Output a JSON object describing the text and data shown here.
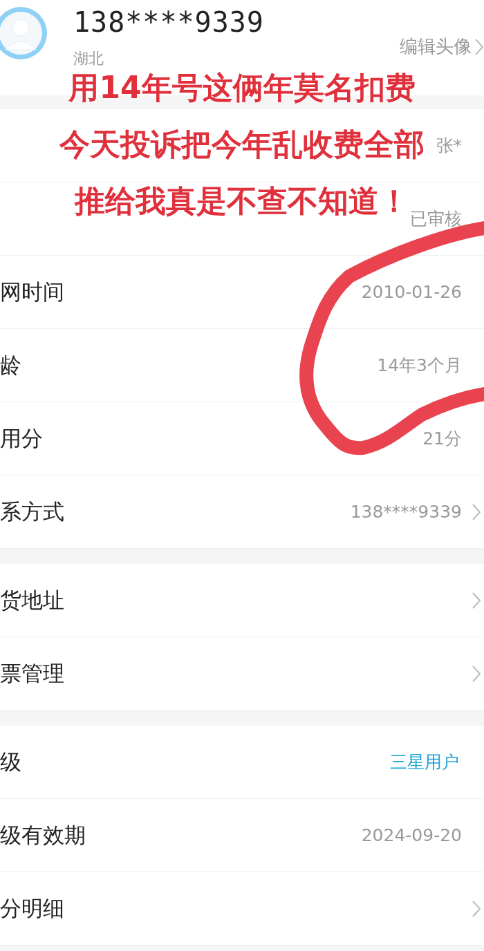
{
  "profile": {
    "phone": "138****9339",
    "region": "湖北",
    "edit_avatar": "编辑头像",
    "chevron": true
  },
  "annotation": {
    "lines": [
      "用14年号这俩年莫名扣费",
      "今天投诉把今年乱收费全部",
      "推给我真是不查不知道！"
    ]
  },
  "sections": [
    [
      {
        "kind": "info",
        "value": "张*",
        "chevron": false
      },
      {
        "kind": "info",
        "value": "已审核",
        "chevron": false
      },
      {
        "kind": "info",
        "label": "网时间",
        "value": "2010-01-26",
        "chevron": false
      },
      {
        "kind": "info",
        "label": "龄",
        "value": "14年3个月",
        "chevron": false
      },
      {
        "kind": "info",
        "label": "用分",
        "value": "21分",
        "chevron": false
      },
      {
        "kind": "info",
        "label": "系方式",
        "value": "138****9339",
        "chevron": true
      }
    ],
    [
      {
        "label": "货地址",
        "chevron": true
      },
      {
        "label": "票管理",
        "chevron": true
      }
    ],
    [
      {
        "kind": "link",
        "label": "级",
        "value": "三星用户",
        "chevron": false
      },
      {
        "kind": "info",
        "label": "级有效期",
        "value": "2024-09-20",
        "chevron": false
      },
      {
        "label": "分明细",
        "chevron": true
      }
    ]
  ]
}
